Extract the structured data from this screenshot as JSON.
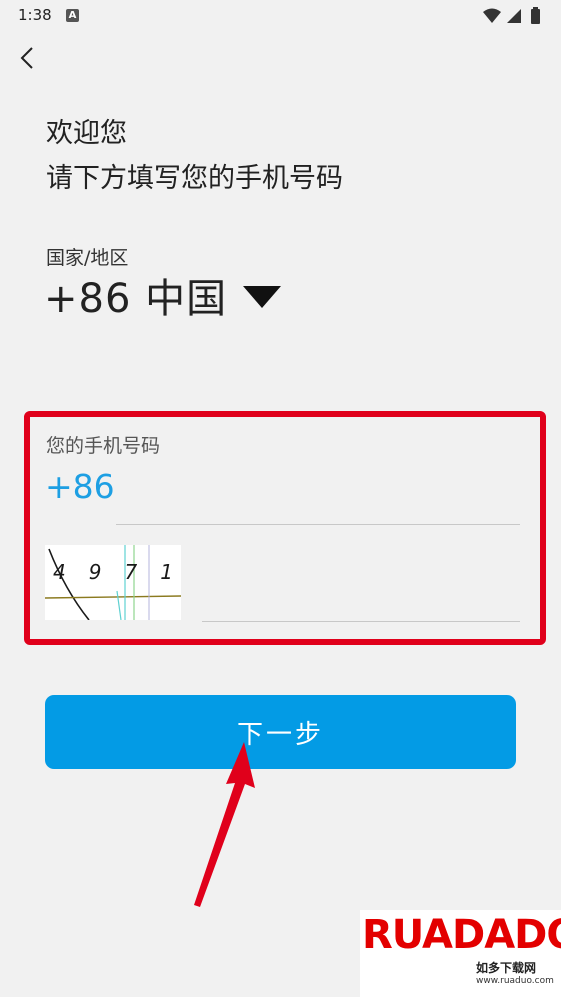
{
  "status_bar": {
    "time": "1:38",
    "notification_icon": "a-notification-icon",
    "icons": [
      "wifi-icon",
      "signal-icon",
      "battery-icon"
    ]
  },
  "nav": {
    "back_icon": "chevron-left-icon"
  },
  "header": {
    "welcome": "欢迎您",
    "instruction": "请下方填写您的手机号码"
  },
  "region": {
    "label": "国家/地区",
    "value": "+86 中国"
  },
  "phone": {
    "label": "您的手机号码",
    "prefix": "+86",
    "value": ""
  },
  "captcha": {
    "image_text": "4971",
    "value": ""
  },
  "actions": {
    "next_label": "下一步"
  },
  "watermark": {
    "brand": "RUADADO",
    "subtitle": "如多下载网",
    "url": "www.ruaduo.com"
  },
  "colors": {
    "accent": "#039be5",
    "highlight": "#e0001b",
    "prefix_blue": "#1d9fe3"
  }
}
